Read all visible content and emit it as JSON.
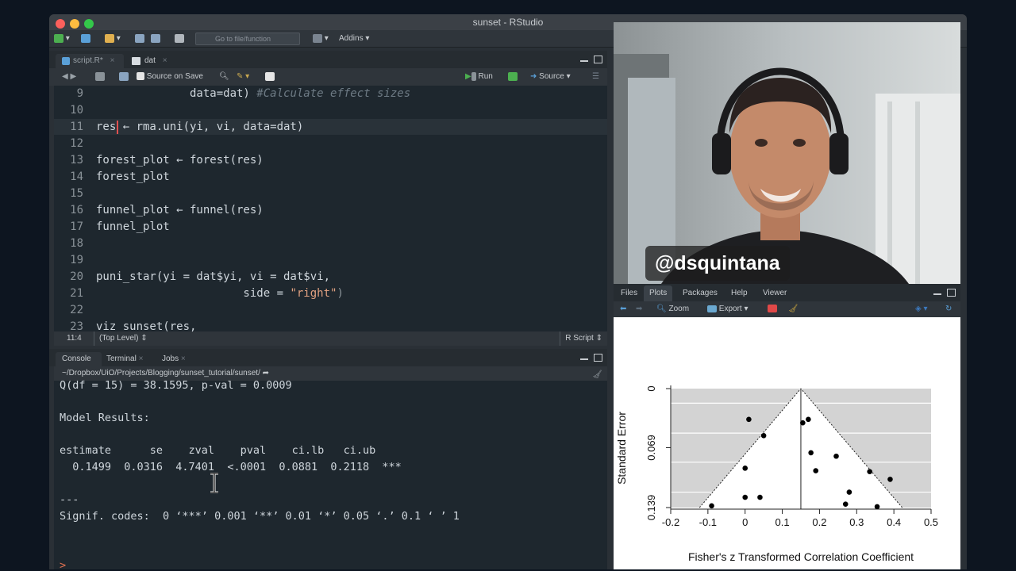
{
  "window": {
    "title": "sunset - RStudio"
  },
  "main_toolbar": {
    "go_to_file": "Go to file/function",
    "addins": "Addins"
  },
  "editor": {
    "tabs": [
      {
        "label": "script.R*"
      },
      {
        "label": "dat"
      }
    ],
    "source_on_save": "Source on Save",
    "run": "Run",
    "source": "Source",
    "lines": [
      {
        "num": "9",
        "code": "              data=dat) ",
        "comment": "#Calculate effect sizes"
      },
      {
        "num": "10",
        "code": ""
      },
      {
        "num": "11",
        "code": "res ← rma.uni(yi, vi, data=dat)"
      },
      {
        "num": "12",
        "code": ""
      },
      {
        "num": "13",
        "code": "forest_plot ← forest(res)"
      },
      {
        "num": "14",
        "code": "forest_plot"
      },
      {
        "num": "15",
        "code": ""
      },
      {
        "num": "16",
        "code": "funnel_plot ← funnel(res)"
      },
      {
        "num": "17",
        "code": "funnel_plot"
      },
      {
        "num": "18",
        "code": ""
      },
      {
        "num": "19",
        "code": ""
      },
      {
        "num": "20",
        "code": "puni_star(yi = dat$yi, vi = dat$vi,"
      },
      {
        "num": "21",
        "code": "                      side = ",
        "string": "\"right\"",
        "tail": ")"
      },
      {
        "num": "22",
        "code": ""
      },
      {
        "num": "23",
        "code": "viz_sunset(res,"
      }
    ],
    "status": {
      "position": "11:4",
      "scope": "(Top Level)",
      "type": "R Script"
    }
  },
  "console": {
    "tabs": [
      {
        "label": "Console"
      },
      {
        "label": "Terminal"
      },
      {
        "label": "Jobs"
      }
    ],
    "path": "~/Dropbox/UiO/Projects/Blogging/sunset_tutorial/sunset/",
    "lines": [
      "Q(df = 15) = 38.1595, p-val = 0.0009",
      "",
      "Model Results:",
      "",
      "estimate      se    zval    pval    ci.lb   ci.ub",
      "  0.1499  0.0316  4.7401  <.0001  0.0881  0.2118  ***",
      "",
      "---",
      "Signif. codes:  0 ‘***’ 0.001 ‘**’ 0.01 ‘*’ 0.05 ‘.’ 0.1 ‘ ’ 1",
      "",
      ">"
    ]
  },
  "video": {
    "handle": "@dsquintana"
  },
  "plots_pane": {
    "tabs": [
      {
        "label": "Files"
      },
      {
        "label": "Plots"
      },
      {
        "label": "Packages"
      },
      {
        "label": "Help"
      },
      {
        "label": "Viewer"
      }
    ],
    "zoom": "Zoom",
    "export": "Export"
  },
  "chart_data": {
    "type": "scatter",
    "title": "",
    "xlabel": "Fisher's z Transformed Correlation Coefficient",
    "ylabel": "Standard Error",
    "xlim": [
      -0.2,
      0.5
    ],
    "ylim": [
      0.139,
      0
    ],
    "y_reversed": true,
    "x_ticks": [
      "-0.2",
      "-0.1",
      "0",
      "0.1",
      "0.2",
      "0.3",
      "0.4",
      "0.5"
    ],
    "y_ticks": [
      "0",
      "0.069",
      "0.139"
    ],
    "estimate": 0.1499,
    "points": [
      {
        "x": 0.01,
        "y": 0.036
      },
      {
        "x": 0.05,
        "y": 0.055
      },
      {
        "x": 0.17,
        "y": 0.036
      },
      {
        "x": 0.155,
        "y": 0.04
      },
      {
        "x": 0.177,
        "y": 0.075
      },
      {
        "x": 0.245,
        "y": 0.079
      },
      {
        "x": 0.19,
        "y": 0.096
      },
      {
        "x": 0.0,
        "y": 0.093
      },
      {
        "x": 0.335,
        "y": 0.097
      },
      {
        "x": 0.39,
        "y": 0.106
      },
      {
        "x": 0.28,
        "y": 0.121
      },
      {
        "x": 0.0,
        "y": 0.127
      },
      {
        "x": 0.04,
        "y": 0.127
      },
      {
        "x": -0.09,
        "y": 0.137
      },
      {
        "x": 0.27,
        "y": 0.135
      },
      {
        "x": 0.355,
        "y": 0.138
      }
    ]
  },
  "colors": {
    "editor_bg": "#1e272e",
    "plot_region": "#d3d3d3",
    "string": "#e0a080",
    "comment": "#6e7b85"
  }
}
